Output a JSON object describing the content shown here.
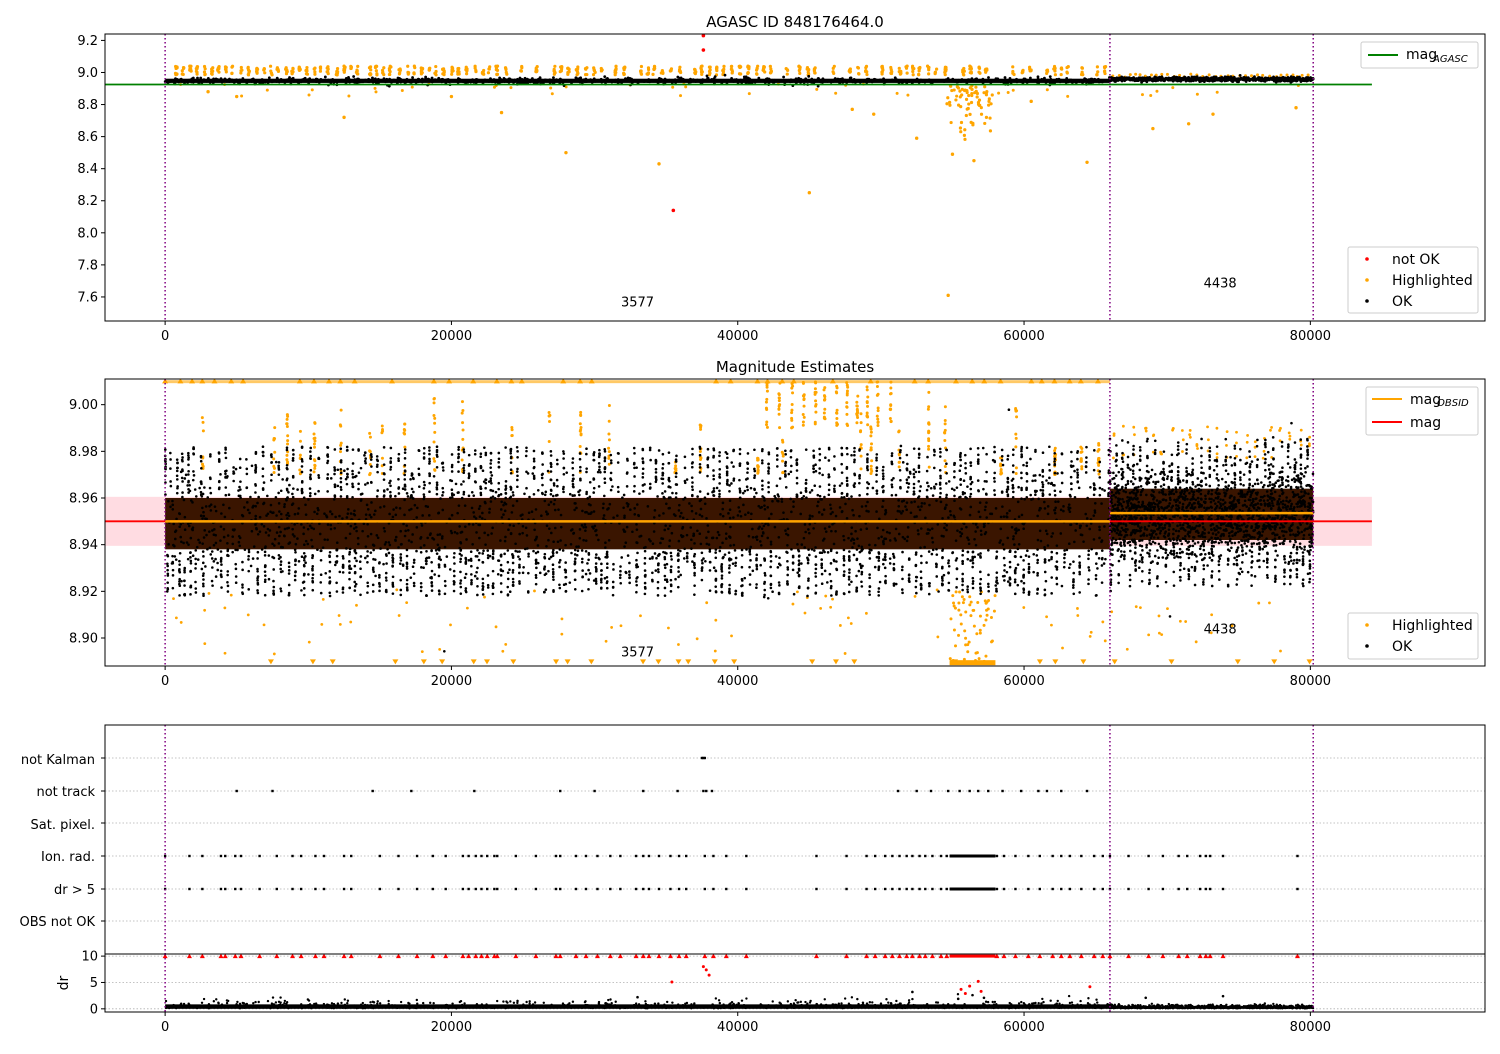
{
  "colors": {
    "ok": "#000000",
    "not_ok": "#ff0000",
    "highlighted": "#ffa500",
    "mag_agasc_line": "#008000",
    "mag_obsid_line": "#ffa500",
    "mag_line": "#ff0000",
    "band": "#ffc0cb",
    "band_dark": "#3a1500",
    "obsid_divider": "#800080",
    "grid": "#b0b0b0"
  },
  "chart_data": [
    {
      "type": "scatter",
      "title": "AGASC ID 848176464.0",
      "xlim": [
        -4200,
        92200
      ],
      "ylim": [
        7.45,
        9.24
      ],
      "xticks": [
        0,
        20000,
        40000,
        60000,
        80000
      ],
      "xtick_labels": [
        "0",
        "20000",
        "40000",
        "60000",
        "80000"
      ],
      "yticks": [
        7.6,
        7.8,
        8.0,
        8.2,
        8.4,
        8.6,
        8.8,
        9.0,
        9.2
      ],
      "ytick_labels": [
        "7.6",
        "7.8",
        "8.0",
        "8.2",
        "8.4",
        "8.6",
        "8.8",
        "9.0",
        "9.2"
      ],
      "obsid_boundaries": [
        0,
        66000,
        80200
      ],
      "obsid_labels": [
        {
          "text": "3577",
          "x": 33000,
          "y": 7.54
        },
        {
          "text": "4438",
          "x": 73700,
          "y": 7.66
        }
      ],
      "reference_line": {
        "name": "mag_AGASC",
        "y": 8.925,
        "x_range": [
          -4200,
          84300
        ]
      },
      "series": [
        {
          "name": "OK",
          "pattern": "dense",
          "segments": [
            {
              "x0": 0,
              "x1": 66000,
              "center": 8.948,
              "spread": 0.022
            },
            {
              "x0": 66000,
              "x1": 80200,
              "center": 8.958,
              "spread": 0.014
            }
          ]
        },
        {
          "name": "Highlighted",
          "pattern": "bursts",
          "y_top": 9.04,
          "scattered": [
            [
              28000,
              8.5
            ],
            [
              34500,
              8.43
            ],
            [
              45000,
              8.25
            ],
            [
              23500,
              8.75
            ],
            [
              12500,
              8.72
            ],
            [
              52500,
              8.59
            ],
            [
              55000,
              8.49
            ],
            [
              56500,
              8.45
            ],
            [
              54700,
              7.61
            ],
            [
              64400,
              8.44
            ],
            [
              69000,
              8.65
            ],
            [
              73200,
              8.74
            ],
            [
              79000,
              8.78
            ],
            [
              49500,
              8.74
            ],
            [
              48000,
              8.77
            ],
            [
              71500,
              8.68
            ],
            [
              60500,
              8.82
            ],
            [
              20000,
              8.85
            ],
            [
              5000,
              8.85
            ],
            [
              3000,
              8.88
            ]
          ]
        },
        {
          "name": "not OK",
          "points": [
            [
              35500,
              8.14
            ],
            [
              37600,
              9.14
            ],
            [
              37600,
              9.23
            ]
          ]
        }
      ],
      "legend_upper": {
        "position": "top-right",
        "entries": [
          {
            "label": "mag",
            "sub": "AGASC",
            "kind": "line",
            "color": "#008000"
          }
        ]
      },
      "legend_lower": {
        "position": "bottom-right",
        "entries": [
          {
            "label": "not OK",
            "kind": "dot",
            "color": "#ff0000"
          },
          {
            "label": "Highlighted",
            "kind": "dot",
            "color": "#ffa500"
          },
          {
            "label": "OK",
            "kind": "dot",
            "color": "#000000"
          }
        ]
      }
    },
    {
      "type": "scatter",
      "title": "Magnitude Estimates",
      "xlim": [
        -4200,
        92200
      ],
      "ylim": [
        8.888,
        9.011
      ],
      "xticks": [
        0,
        20000,
        40000,
        60000,
        80000
      ],
      "xtick_labels": [
        "0",
        "20000",
        "40000",
        "60000",
        "80000"
      ],
      "yticks": [
        8.9,
        8.92,
        8.94,
        8.96,
        8.98,
        9.0
      ],
      "ytick_labels": [
        "8.90",
        "8.92",
        "8.94",
        "8.96",
        "8.98",
        "9.00"
      ],
      "obsid_boundaries": [
        0,
        66000,
        80200
      ],
      "obsid_labels": [
        {
          "text": "3577",
          "x": 33000,
          "y": 8.892
        },
        {
          "text": "4438",
          "x": 73700,
          "y": 8.902
        }
      ],
      "mag": {
        "value": 8.95,
        "band": [
          8.9395,
          8.9605
        ],
        "x_range": [
          -4200,
          84300
        ]
      },
      "mag_obsid": [
        {
          "x0": 0,
          "x1": 66000,
          "value": 8.95
        },
        {
          "x0": 66000,
          "x1": 80200,
          "value": 8.9535
        }
      ],
      "series": [
        {
          "name": "OK",
          "pattern": "dense",
          "segments": [
            {
              "x0": 0,
              "x1": 66000,
              "center": 8.949,
              "spread": 0.03
            },
            {
              "x0": 66000,
              "x1": 80200,
              "center": 8.953,
              "spread": 0.024
            }
          ]
        },
        {
          "name": "Highlighted",
          "pattern": "overflow",
          "overflow_top": 9.01,
          "overflow_bottom": 8.89
        }
      ],
      "legend_upper": {
        "position": "top-right",
        "entries": [
          {
            "label": "mag",
            "sub": "OBSID",
            "kind": "line",
            "color": "#ffa500"
          },
          {
            "label": "mag",
            "sub": "",
            "kind": "line",
            "color": "#ff0000"
          }
        ]
      },
      "legend_lower": {
        "position": "bottom-right",
        "entries": [
          {
            "label": "Highlighted",
            "kind": "dot",
            "color": "#ffa500"
          },
          {
            "label": "OK",
            "kind": "dot",
            "color": "#000000"
          }
        ]
      }
    },
    {
      "type": "scatter",
      "title": "",
      "xlim": [
        -4200,
        92200
      ],
      "flag_rows": [
        "not Kalman",
        "not track",
        "Sat. pixel.",
        "Ion. rad.",
        "dr > 5",
        "OBS not OK"
      ],
      "obsid_boundaries": [
        0,
        66000,
        80200
      ],
      "flags": {
        "not Kalman": [
          37500,
          37600,
          37700
        ],
        "not track": [
          5000,
          7500,
          14500,
          17200,
          21600,
          27600,
          30000,
          33400,
          35800,
          37600,
          37800,
          38200,
          51200,
          52500,
          53500,
          54700,
          55500,
          56200,
          56800,
          57500,
          58500,
          59800,
          61000,
          61600,
          62600,
          64400
        ],
        "Sat. pixel.": [],
        "Ion. rad.": [
          0,
          1700,
          2600,
          3900,
          4200,
          4900,
          5300,
          6600,
          7800,
          8900,
          9500,
          10500,
          11100,
          12500,
          13000,
          15000,
          16300,
          17600,
          18700,
          19600,
          20800,
          21200,
          21700,
          22100,
          22500,
          23000,
          23200,
          24500,
          25900,
          27300,
          27600,
          28700,
          29400,
          30200,
          31100,
          31800,
          32900,
          33400,
          33800,
          34500,
          35300,
          35900,
          36400,
          37700,
          38300,
          39200,
          40600,
          45500,
          47600,
          49000,
          49600,
          50300,
          50800,
          51300,
          51800,
          52200,
          52700,
          53100,
          53600,
          54200,
          54600,
          58100,
          58600,
          59400,
          60300,
          61100,
          62000,
          62600,
          63200,
          64000,
          64900,
          65500,
          66000,
          67300,
          68700,
          69700,
          70800,
          71400,
          72300,
          72700,
          73000,
          73900,
          79100
        ],
        "dr > 5": [
          0,
          1700,
          2600,
          3900,
          4200,
          4900,
          5300,
          6600,
          7800,
          8900,
          9500,
          10500,
          11100,
          12500,
          13000,
          15000,
          16300,
          17600,
          18700,
          19600,
          20800,
          21200,
          21700,
          22100,
          22500,
          23000,
          23200,
          24500,
          25900,
          27300,
          27600,
          28700,
          29400,
          30200,
          31100,
          31800,
          32900,
          33400,
          33800,
          34500,
          35300,
          35900,
          36400,
          37700,
          38300,
          39200,
          40600,
          45500,
          47600,
          49000,
          49600,
          50300,
          50800,
          51300,
          51800,
          52200,
          52700,
          53100,
          53600,
          54200,
          54600,
          58100,
          58600,
          59400,
          60300,
          61100,
          62000,
          62600,
          63200,
          64000,
          64900,
          65500,
          66000,
          67300,
          68700,
          69700,
          70800,
          71400,
          72300,
          72700,
          73000,
          73900,
          79100
        ],
        "OBS not OK": []
      },
      "flag_clusters": [
        {
          "row": "Ion. rad.",
          "x0": 54800,
          "x1": 58000
        },
        {
          "row": "dr > 5",
          "x0": 54800,
          "x1": 58000
        }
      ]
    },
    {
      "type": "scatter",
      "title": "",
      "xlim": [
        -4200,
        92200
      ],
      "ylim": [
        -0.6,
        10.4
      ],
      "ylabel": "dr",
      "xticks": [
        0,
        20000,
        40000,
        60000,
        80000
      ],
      "xtick_labels": [
        "0",
        "20000",
        "40000",
        "60000",
        "80000"
      ],
      "yticks": [
        0,
        5,
        10
      ],
      "ytick_labels": [
        "0",
        "5",
        "10"
      ],
      "obsid_boundaries": [
        0,
        66000,
        80200
      ],
      "series": [
        {
          "name": "OK",
          "pattern": "dense",
          "segments": [
            {
              "x0": 0,
              "x1": 66000,
              "center": 0.5,
              "spread": 0.7
            },
            {
              "x0": 66000,
              "x1": 80200,
              "center": 0.3,
              "spread": 0.3
            }
          ]
        },
        {
          "name": "not OK",
          "points": [
            [
              35400,
              5.1
            ],
            [
              37600,
              8.0
            ],
            [
              37800,
              7.4
            ],
            [
              38000,
              6.4
            ],
            [
              55600,
              3.7
            ],
            [
              56200,
              4.3
            ],
            [
              57000,
              3.3
            ],
            [
              64600,
              4.2
            ],
            [
              56800,
              5.2
            ],
            [
              55900,
              2.9
            ]
          ]
        }
      ],
      "capped_y": 10,
      "extra_points": [
        [
          33000,
          2.2
        ],
        [
          52200,
          3.2
        ],
        [
          68500,
          2.1
        ],
        [
          73900,
          2.4
        ],
        [
          56400,
          2.6
        ],
        [
          57200,
          2.1
        ],
        [
          55400,
          1.9
        ]
      ]
    }
  ]
}
